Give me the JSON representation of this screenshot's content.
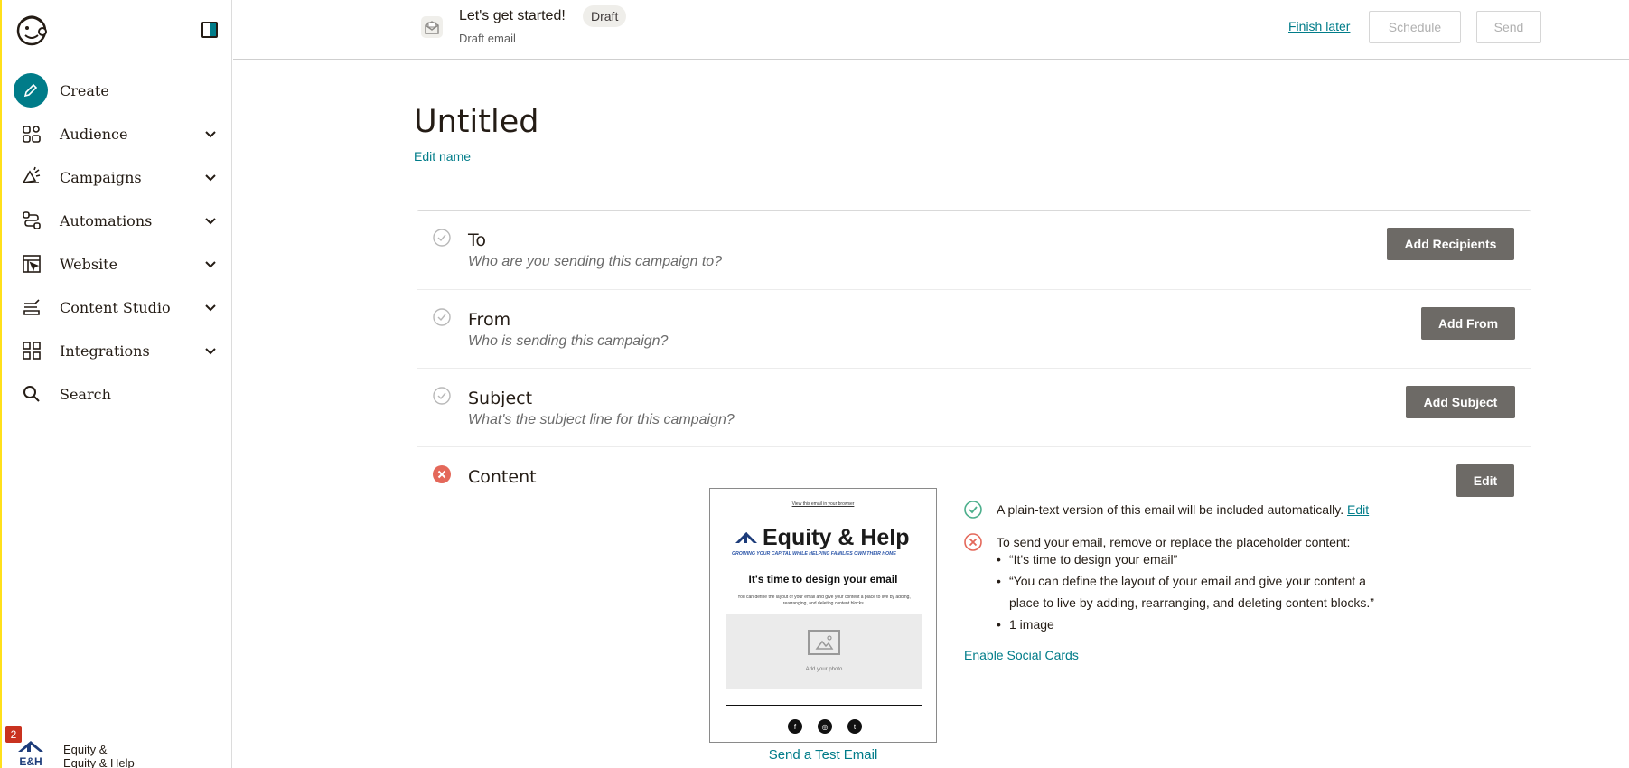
{
  "sidebar": {
    "items": [
      {
        "label": "Create",
        "icon": "pencil-icon"
      },
      {
        "label": "Audience",
        "icon": "audience-icon"
      },
      {
        "label": "Campaigns",
        "icon": "megaphone-icon"
      },
      {
        "label": "Automations",
        "icon": "automation-icon"
      },
      {
        "label": "Website",
        "icon": "website-icon"
      },
      {
        "label": "Content Studio",
        "icon": "content-studio-icon"
      },
      {
        "label": "Integrations",
        "icon": "grid-icon"
      },
      {
        "label": "Search",
        "icon": "search-icon"
      }
    ],
    "account": {
      "badge": "2",
      "name": "Equity &",
      "sub": "Equity & Help",
      "logo_text": "E&H"
    }
  },
  "header": {
    "title": "Let's get started!",
    "status": "Draft",
    "subtitle": "Draft email",
    "finish_later": "Finish later",
    "schedule": "Schedule",
    "send": "Send"
  },
  "campaign": {
    "name": "Untitled",
    "edit_name": "Edit name"
  },
  "checklist": {
    "to": {
      "label": "To",
      "hint": "Who are you sending this campaign to?",
      "button": "Add Recipients"
    },
    "from": {
      "label": "From",
      "hint": "Who is sending this campaign?",
      "button": "Add From"
    },
    "subject": {
      "label": "Subject",
      "hint": "What's the subject line for this campaign?",
      "button": "Add Subject"
    },
    "content": {
      "label": "Content",
      "button": "Edit",
      "preview": {
        "top_link": "View this email in your browser",
        "brand": "Equity & Help",
        "tagline": "GROWING YOUR CAPITAL WHILE HELPING FAMILIES OWN THEIR HOME",
        "heading": "It's time to design your email",
        "body": "You can define the layout of your email and give your content a place to live by adding, rearranging, and deleting content blocks.",
        "photo_label": "Add your photo",
        "social": [
          "f",
          "◎",
          "t"
        ]
      },
      "test_email": "Send a Test Email",
      "plain_text_note": "A plain-text version of this email will be included automatically.",
      "plain_text_edit": "Edit",
      "placeholder_warning": "To send your email, remove or replace the placeholder content:",
      "placeholders": [
        "“It's time to design your email”",
        "“You can define the layout of your email and give your content a",
        "place to live by adding, rearranging, and deleting content blocks.”",
        "1 image"
      ],
      "social_cards": "Enable Social Cards"
    }
  },
  "colors": {
    "accent": "#007c89",
    "dark_button": "#6d6a66",
    "error": "#e4685a",
    "success": "#4caf8c",
    "edge": "#ffe01b"
  }
}
